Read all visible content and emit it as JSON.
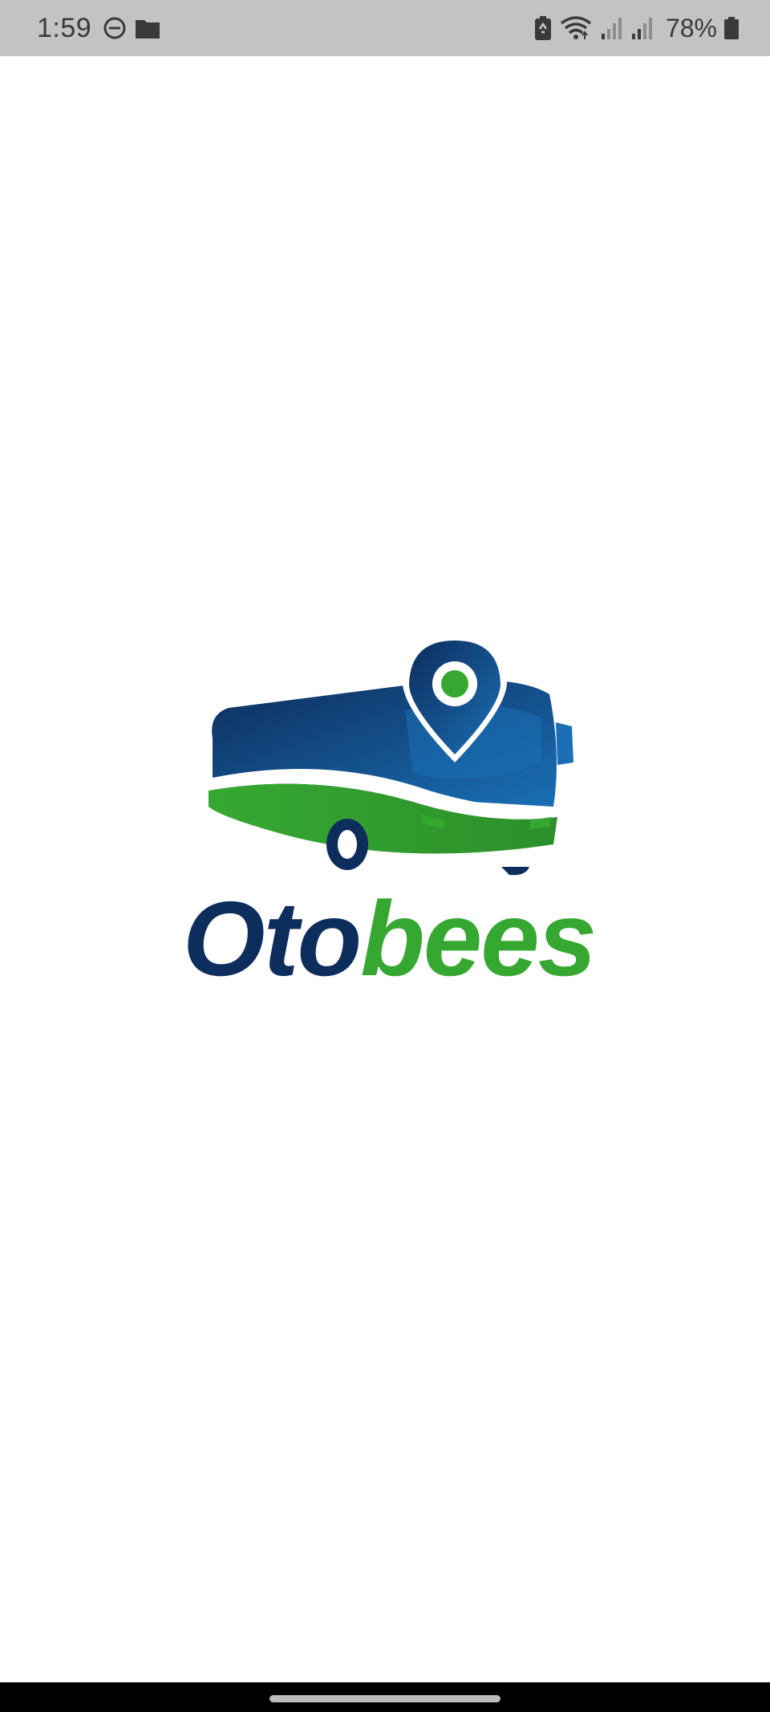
{
  "status_bar": {
    "time": "1:59",
    "battery_text": "78%",
    "left_icons": [
      "do-not-disturb-icon",
      "folder-icon"
    ],
    "right_icons": [
      "battery-saver-icon",
      "wifi-icon",
      "signal-icon",
      "signal-icon",
      "battery-icon"
    ],
    "background": "#c3c3c3"
  },
  "splash": {
    "logo_text_part1": "Oto",
    "logo_text_part2": "bees",
    "brand_navy": "#0d2d5c",
    "brand_green": "#36a832",
    "brand_blue": "#1a6fb5"
  },
  "navigation": {
    "home_indicator": "home-indicator"
  }
}
